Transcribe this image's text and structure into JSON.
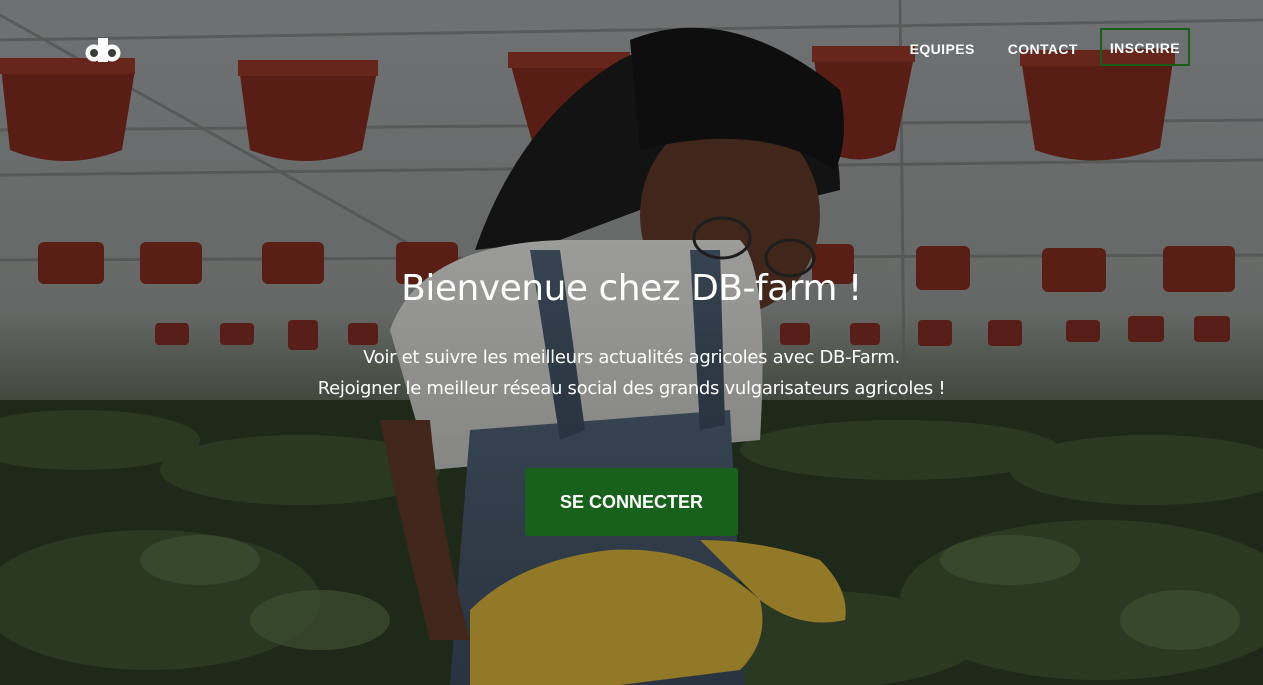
{
  "brand": {
    "logo_text": "db",
    "logo_icon": "db-logo-icon"
  },
  "nav": {
    "links": [
      "EQUIPES",
      "CONTACT"
    ],
    "register_label": "INSCRIRE"
  },
  "hero": {
    "title": "Bienvenue chez DB-farm !",
    "subtitle_line1": "Voir et suivre les meilleurs actualités agricoles avec DB-Farm.",
    "subtitle_line2": "Rejoigner le meilleur réseau social des grands vulgarisateurs agricoles !",
    "cta_label": "SE CONNECTER",
    "background_description": "greenhouse-woman-gardening-photo"
  },
  "colors": {
    "accent": "#18611c",
    "text": "#ffffff",
    "nav_button_border": "#1a5c1c"
  }
}
